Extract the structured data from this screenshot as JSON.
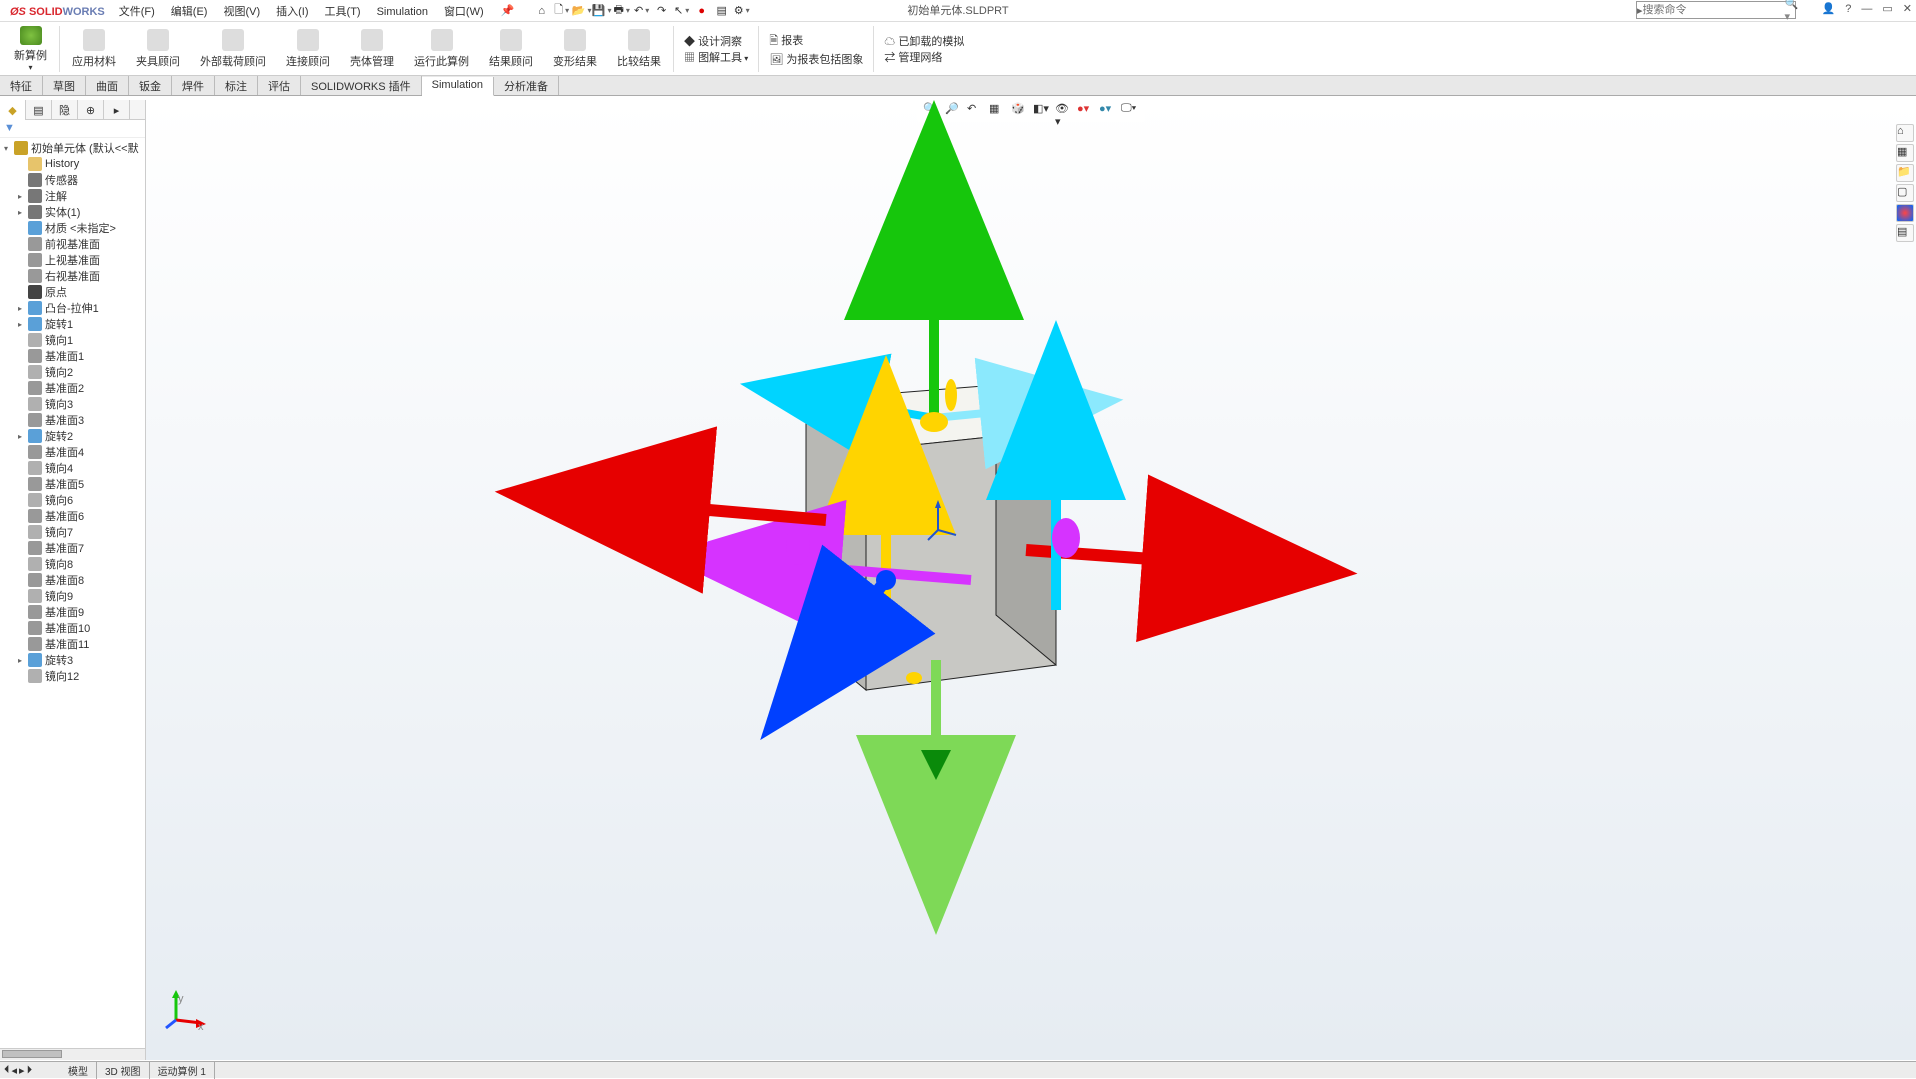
{
  "app": {
    "brand1": "SOLID",
    "brand2": "WORKS"
  },
  "menus": [
    "文件(F)",
    "编辑(E)",
    "视图(V)",
    "插入(I)",
    "工具(T)",
    "Simulation",
    "窗口(W)"
  ],
  "file_title": "初始单元体.SLDPRT",
  "search_placeholder": "搜索命令",
  "ribbon": {
    "new_study": "新算例",
    "items": [
      "应用材料",
      "夹具顾问",
      "外部载荷顾问",
      "连接顾问",
      "壳体管理",
      "运行此算例",
      "结果顾问",
      "变形结果",
      "比较结果"
    ],
    "design": {
      "a": "设计洞察",
      "b": "图解工具"
    },
    "report": {
      "a": "报表",
      "b": "为报表包括图象"
    },
    "sim": {
      "a": "已卸载的模拟",
      "b": "管理网络"
    }
  },
  "tabs": [
    "特征",
    "草图",
    "曲面",
    "钣金",
    "焊件",
    "标注",
    "评估",
    "SOLIDWORKS 插件",
    "Simulation",
    "分析准备"
  ],
  "active_tab": "Simulation",
  "tree_root": "初始单元体  (默认<<默",
  "tree": [
    {
      "label": "History",
      "ic": "folder",
      "ind": 1,
      "exp": ""
    },
    {
      "label": "传感器",
      "ic": "sensor",
      "ind": 1,
      "exp": ""
    },
    {
      "label": "注解",
      "ic": "note",
      "ind": 1,
      "exp": "▸"
    },
    {
      "label": "实体(1)",
      "ic": "solid",
      "ind": 1,
      "exp": "▸"
    },
    {
      "label": "材质 <未指定>",
      "ic": "mat",
      "ind": 1,
      "exp": ""
    },
    {
      "label": "前视基准面",
      "ic": "plane",
      "ind": 1,
      "exp": ""
    },
    {
      "label": "上视基准面",
      "ic": "plane",
      "ind": 1,
      "exp": ""
    },
    {
      "label": "右视基准面",
      "ic": "plane",
      "ind": 1,
      "exp": ""
    },
    {
      "label": "原点",
      "ic": "origin",
      "ind": 1,
      "exp": ""
    },
    {
      "label": "凸台-拉伸1",
      "ic": "extr",
      "ind": 1,
      "exp": "▸"
    },
    {
      "label": "旋转1",
      "ic": "rev",
      "ind": 1,
      "exp": "▸"
    },
    {
      "label": "镜向1",
      "ic": "mir",
      "ind": 1,
      "exp": ""
    },
    {
      "label": "基准面1",
      "ic": "plane",
      "ind": 1,
      "exp": ""
    },
    {
      "label": "镜向2",
      "ic": "mir",
      "ind": 1,
      "exp": ""
    },
    {
      "label": "基准面2",
      "ic": "plane",
      "ind": 1,
      "exp": ""
    },
    {
      "label": "镜向3",
      "ic": "mir",
      "ind": 1,
      "exp": ""
    },
    {
      "label": "基准面3",
      "ic": "plane",
      "ind": 1,
      "exp": ""
    },
    {
      "label": "旋转2",
      "ic": "rev",
      "ind": 1,
      "exp": "▸"
    },
    {
      "label": "基准面4",
      "ic": "plane",
      "ind": 1,
      "exp": ""
    },
    {
      "label": "镜向4",
      "ic": "mir",
      "ind": 1,
      "exp": ""
    },
    {
      "label": "基准面5",
      "ic": "plane",
      "ind": 1,
      "exp": ""
    },
    {
      "label": "镜向6",
      "ic": "mir",
      "ind": 1,
      "exp": ""
    },
    {
      "label": "基准面6",
      "ic": "plane",
      "ind": 1,
      "exp": ""
    },
    {
      "label": "镜向7",
      "ic": "mir",
      "ind": 1,
      "exp": ""
    },
    {
      "label": "基准面7",
      "ic": "plane",
      "ind": 1,
      "exp": ""
    },
    {
      "label": "镜向8",
      "ic": "mir",
      "ind": 1,
      "exp": ""
    },
    {
      "label": "基准面8",
      "ic": "plane",
      "ind": 1,
      "exp": ""
    },
    {
      "label": "镜向9",
      "ic": "mir",
      "ind": 1,
      "exp": ""
    },
    {
      "label": "基准面9",
      "ic": "plane",
      "ind": 1,
      "exp": ""
    },
    {
      "label": "基准面10",
      "ic": "plane",
      "ind": 1,
      "exp": ""
    },
    {
      "label": "基准面11",
      "ic": "plane",
      "ind": 1,
      "exp": ""
    },
    {
      "label": "旋转3",
      "ic": "rev",
      "ind": 1,
      "exp": "▸"
    },
    {
      "label": "镜向12",
      "ic": "mir",
      "ind": 1,
      "exp": ""
    }
  ],
  "bottom_tabs": [
    "模型",
    "3D 视图",
    "运动算例 1"
  ],
  "icons": {
    "folder": "#e7c46b",
    "sensor": "#777",
    "note": "#777",
    "solid": "#777",
    "mat": "#5aa0d8",
    "plane": "#999",
    "origin": "#444",
    "extr": "#5aa0d8",
    "rev": "#5aa0d8",
    "mir": "#b0b0b0"
  }
}
